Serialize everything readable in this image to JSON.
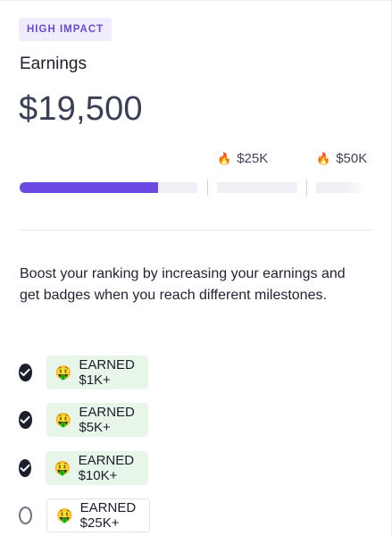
{
  "badge": "HIGH IMPACT",
  "title": "Earnings",
  "amount": "$19,500",
  "progress": {
    "current_value": 19500,
    "segment_1_fill_fraction": 0.78,
    "milestones": [
      {
        "icon": "fire-icon",
        "glyph": "🔥",
        "label": "$25K"
      },
      {
        "icon": "fire-icon",
        "glyph": "🔥",
        "label": "$50K"
      }
    ],
    "fill_color": "#6a4ae2",
    "track_color": "#eef0f5"
  },
  "description": "Boost your ranking by increasing your earnings and get badges when you reach different milestones.",
  "badges": [
    {
      "label": "EARNED $1K+",
      "emoji": "🤑",
      "earned": true
    },
    {
      "label": "EARNED $5K+",
      "emoji": "🤑",
      "earned": true
    },
    {
      "label": "EARNED $10K+",
      "emoji": "🤑",
      "earned": true
    },
    {
      "label": "EARNED $25K+",
      "emoji": "🤑",
      "earned": false
    }
  ],
  "colors": {
    "accent": "#6a4ad1",
    "earned_bg": "#e8f6ea",
    "badge_bg": "#f0ecfd"
  }
}
